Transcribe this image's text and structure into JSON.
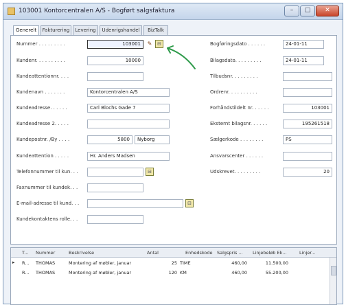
{
  "window": {
    "title": "103001 Kontorcentralen A/S - Bogført salgsfaktura",
    "minimize": "–",
    "maximize": "□",
    "close": "✕"
  },
  "tabs": [
    "Generelt",
    "Fakturering",
    "Levering",
    "Udenrigshandel",
    "BizTalk"
  ],
  "left_fields": [
    {
      "label": "Nummer . . . . . . . . .",
      "value": "103001"
    },
    {
      "label": "Kundenr. . . . . . . . . .",
      "value": "10000"
    },
    {
      "label": "Kundeattentionnr. . . .",
      "value": ""
    },
    {
      "label": "Kundenavn . . . . . . .",
      "value": "Kontorcentralen A/S"
    },
    {
      "label": "Kundeadresse. . . . . .",
      "value": "Carl Blochs Gade 7"
    },
    {
      "label": "Kundeadresse 2. . . . .",
      "value": ""
    },
    {
      "label": "Kundepostnr. /By . . . .",
      "value": "5800",
      "value2": "Nyborg"
    },
    {
      "label": "Kundeattention . . . . .",
      "value": "Hr. Anders Madsen"
    },
    {
      "label": "Telefonnummer til kun. . .",
      "value": ""
    },
    {
      "label": "Faxnummer til kundek. . .",
      "value": ""
    },
    {
      "label": "E-mail-adresse til kund. . .",
      "value": ""
    },
    {
      "label": "Kundekontaktens rolle. . .",
      "value": ""
    }
  ],
  "right_fields": [
    {
      "label": "Bogføringsdato . . . . . .",
      "value": "24-01-11"
    },
    {
      "label": "Bilagsdato. . . . . . . . .",
      "value": "24-01-11"
    },
    {
      "label": "Tilbudsnr. . . . . . . . .",
      "value": ""
    },
    {
      "label": "Ordrenr. . . . . . . . . .",
      "value": ""
    },
    {
      "label": "Forhåndstildelt nr. . . . . .",
      "value": "103001"
    },
    {
      "label": "Eksternt bilagsnr. . . . . .",
      "value": "195261518"
    },
    {
      "label": "Sælgerkode . . . . . . . .",
      "value": "PS"
    },
    {
      "label": "Ansvarscenter . . . . . .",
      "value": ""
    },
    {
      "label": "Udskrevet. . . . . . . . .",
      "value": "20"
    }
  ],
  "icons": {
    "edit": "✎",
    "lookup": "⊟"
  },
  "lines": {
    "headers": [
      "T...",
      "Nummer",
      "Beskrivelse",
      "Antal",
      "Enhedskode",
      "Salgspris ...",
      "Linjebeløb Ek...",
      "Linjer..."
    ],
    "rows": [
      [
        "R...",
        "THOMAS",
        "Montering af møbler, januar",
        "25",
        "TIME",
        "460,00",
        "11.500,00",
        ""
      ],
      [
        "R...",
        "THOMAS",
        "Montering af møbler, januar",
        "120",
        "KM",
        "460,00",
        "55.200,00",
        ""
      ]
    ],
    "selector": "▸"
  },
  "colors": {
    "accent_arrow": "#2e9a4a",
    "titlebar": "#c4d5eb"
  }
}
